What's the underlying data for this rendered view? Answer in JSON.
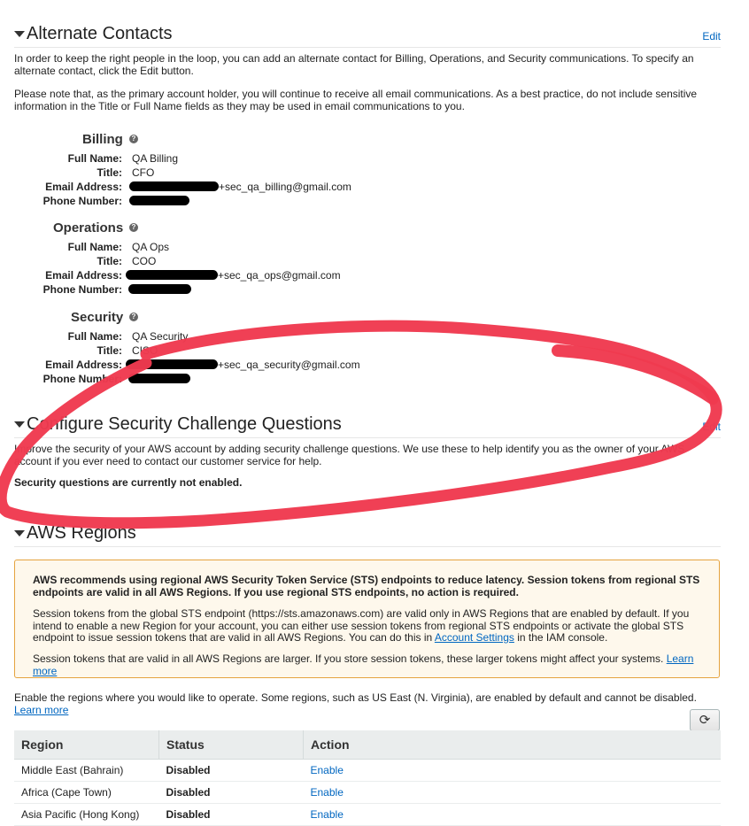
{
  "alternate_contacts": {
    "title": "Alternate Contacts",
    "edit_label": "Edit",
    "intro": "In order to keep the right people in the loop, you can add an alternate contact for Billing, Operations, and Security communications. To specify an alternate contact, click the Edit button.",
    "note": "Please note that, as the primary account holder, you will continue to receive all email communications. As a best practice, do not include sensitive information in the Title or Full Name fields as they may be used in email communications to you.",
    "labels": {
      "full_name": "Full Name:",
      "title": "Title:",
      "email": "Email Address:",
      "phone": "Phone Number:"
    },
    "contacts": [
      {
        "heading": "Billing",
        "full_name": "QA Billing",
        "title": "CFO",
        "email_suffix": "+sec_qa_billing@gmail.com"
      },
      {
        "heading": "Operations",
        "full_name": "QA Ops",
        "title": "COO",
        "email_suffix": "+sec_qa_ops@gmail.com"
      },
      {
        "heading": "Security",
        "full_name": "QA Security",
        "title": "CISO",
        "email_suffix": "+sec_qa_security@gmail.com"
      }
    ],
    "help_icon_glyph": "?"
  },
  "security_questions": {
    "title": "Configure Security Challenge Questions",
    "edit_label": "Edit",
    "intro": "Improve the security of your AWS account by adding security challenge questions. We use these to help identify you as the owner of your AWS account if you ever need to contact our customer service for help.",
    "status": "Security questions are currently not enabled."
  },
  "aws_regions": {
    "title": "AWS Regions",
    "notice": {
      "headline": "AWS recommends using regional AWS Security Token Service (STS) endpoints to reduce latency. Session tokens from regional STS endpoints are valid in all AWS Regions. If you use regional STS endpoints, no action is required.",
      "para1_before": "Session tokens from the global STS endpoint (https://sts.amazonaws.com) are valid only in AWS Regions that are enabled by default. If you intend to enable a new Region for your account, you can either use session tokens from regional STS endpoints or activate the global STS endpoint to issue session tokens that are valid in all AWS Regions. You can do this in ",
      "para1_link": "Account Settings",
      "para1_after": " in the IAM console.",
      "para2_before": "Session tokens that are valid in all AWS Regions are larger. If you store session tokens, these larger tokens might affect your systems. ",
      "para2_link": "Learn more"
    },
    "enable_text": "Enable the regions where you would like to operate. Some regions, such as US East (N. Virginia), are enabled by default and cannot be disabled. ",
    "enable_link": "Learn more",
    "refresh_glyph": "⟳",
    "table": {
      "headers": [
        "Region",
        "Status",
        "Action"
      ],
      "rows": [
        {
          "region": "Middle East (Bahrain)",
          "status": "Disabled",
          "action": "Enable"
        },
        {
          "region": "Africa (Cape Town)",
          "status": "Disabled",
          "action": "Enable"
        },
        {
          "region": "Asia Pacific (Hong Kong)",
          "status": "Disabled",
          "action": "Enable"
        }
      ]
    }
  },
  "colors": {
    "link": "#0066c0",
    "annotation": "#ef3a4f",
    "notice_border": "#e5a33f",
    "notice_bg": "#fef8ec"
  }
}
